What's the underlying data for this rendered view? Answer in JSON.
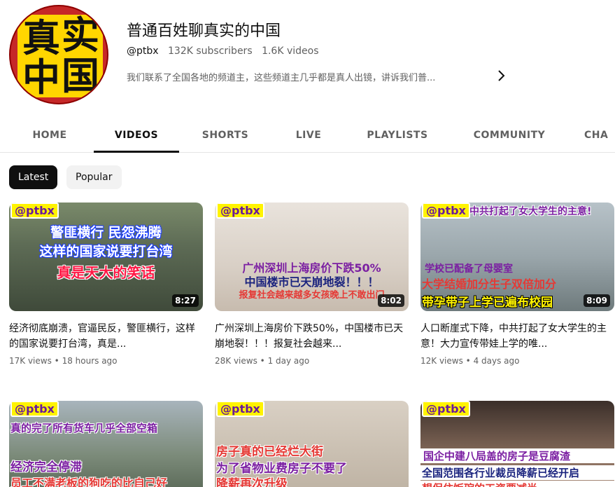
{
  "channel": {
    "avatar_text": [
      "真",
      "实",
      "中",
      "国"
    ],
    "name": "普通百姓聊真实的中国",
    "handle": "@ptbx",
    "subscribers": "132K subscribers",
    "videos": "1.6K videos",
    "description": "我们联系了全国各地的频道主，这些频道主几乎都是真人出镜，讲诉我们普..."
  },
  "tabs": [
    "HOME",
    "VIDEOS",
    "SHORTS",
    "LIVE",
    "PLAYLISTS",
    "COMMUNITY",
    "CHA"
  ],
  "active_tab": "VIDEOS",
  "chips": [
    "Latest",
    "Popular"
  ],
  "videos": [
    {
      "thumb_tag": "@ptbx",
      "thumb_lines": [
        "警匪横行 民怨沸腾",
        "这样的国家说要打台湾",
        "真是天大的笑话"
      ],
      "duration": "8:27",
      "title": "经济彻底崩溃，官逼民反，警匪横行，这样的国家说要打台湾，真是...",
      "views": "17K views",
      "age": "18 hours ago"
    },
    {
      "thumb_tag": "@ptbx",
      "thumb_lines": [
        "广州深圳上海房价下跌50%",
        "中国楼市已天崩地裂！！！",
        "报复社会越来越多女孩晚上不敢出门"
      ],
      "duration": "8:02",
      "title": "广州深圳上海房价下跌50%，中国楼市已天崩地裂！！！报复社会越来...",
      "views": "28K views",
      "age": "1 day ago"
    },
    {
      "thumb_tag": "@ptbx",
      "thumb_lines": [
        "中共打起了女大学生的主意!",
        "学校已配备了母婴室",
        "大学结婚加分生子双倍加分",
        "带孕带子上学已遍布校园"
      ],
      "duration": "8:09",
      "title": "人口断崖式下降，中共打起了女大学生的主意！大力宣传带娃上学的唯...",
      "views": "12K views",
      "age": "4 days ago"
    },
    {
      "thumb_tag": "@ptbx",
      "thumb_lines": [
        "真的完了所有货车几乎全部空箱",
        "经济完全停滞",
        "员工不满老板的狗吃的比自己好"
      ],
      "duration": "",
      "title": "",
      "views": "",
      "age": ""
    },
    {
      "thumb_tag": "@ptbx",
      "thumb_lines": [
        "房子真的已经烂大街",
        "为了省物业费房子不要了",
        "降薪再次升级"
      ],
      "duration": "",
      "title": "",
      "views": "",
      "age": ""
    },
    {
      "thumb_tag": "@ptbx",
      "thumb_lines": [
        "国企中建八局盖的房子是豆腐渣",
        "全国范围各行业裁员降薪已经开启",
        "想保住饭碗的工资要减半"
      ],
      "duration": "",
      "title": "",
      "views": "",
      "age": ""
    }
  ],
  "colors": {
    "text_primary": "#0f0f0f",
    "text_secondary": "#606060",
    "chip_selected_bg": "#0f0f0f",
    "chip_bg": "#f2f2f2",
    "avatar_red": "#c62828",
    "avatar_yellow": "#ffd600",
    "thumb_tag_yellow": "#fff300"
  },
  "icons": {
    "description_more": "chevron-right-icon"
  }
}
